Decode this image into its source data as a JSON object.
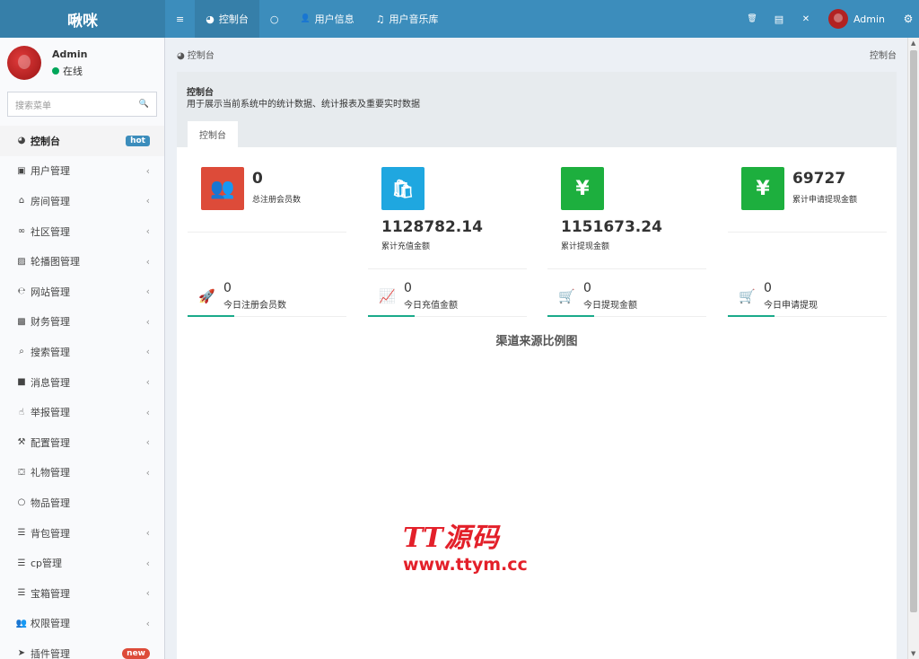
{
  "app": {
    "logo": "啾咪"
  },
  "topnav": {
    "menu_icon": "≡",
    "tabs": [
      {
        "label": "控制台",
        "icon": "dashboard-icon",
        "glyph": "◕"
      },
      {
        "label": "",
        "icon": "circle-icon",
        "glyph": "○"
      },
      {
        "label": "用户信息",
        "icon": "user-icon",
        "glyph": "👤"
      },
      {
        "label": "用户音乐库",
        "icon": "music-icon",
        "glyph": "♫"
      }
    ],
    "right_icons": [
      {
        "icon": "trash-icon",
        "glyph": "🗑"
      },
      {
        "icon": "translate-icon",
        "glyph": "▤"
      },
      {
        "icon": "fullscreen-icon",
        "glyph": "✕"
      }
    ],
    "user": "Admin",
    "settings_glyph": "⚙"
  },
  "sidebar": {
    "user_name": "Admin",
    "user_status": "在线",
    "search_placeholder": "搜索菜单",
    "search_glyph": "🔍",
    "items": [
      {
        "label": "控制台",
        "glyph": "◕",
        "icon": "dashboard-icon",
        "badge": "hot",
        "active": true
      },
      {
        "label": "用户管理",
        "glyph": "▣",
        "icon": "user-card-icon"
      },
      {
        "label": "房间管理",
        "glyph": "⌂",
        "icon": "bank-icon"
      },
      {
        "label": "社区管理",
        "glyph": "∞",
        "icon": "bicycle-icon"
      },
      {
        "label": "轮播图管理",
        "glyph": "▨",
        "icon": "image-icon"
      },
      {
        "label": "网站管理",
        "glyph": "℮",
        "icon": "ie-icon"
      },
      {
        "label": "财务管理",
        "glyph": "▩",
        "icon": "money-icon"
      },
      {
        "label": "搜索管理",
        "glyph": "⌕",
        "icon": "search-icon"
      },
      {
        "label": "消息管理",
        "glyph": "■",
        "icon": "message-icon"
      },
      {
        "label": "举报管理",
        "glyph": "☝",
        "icon": "hand-icon"
      },
      {
        "label": "配置管理",
        "glyph": "⚒",
        "icon": "sitemap-icon"
      },
      {
        "label": "礼物管理",
        "glyph": "⛋",
        "icon": "gift-icon"
      },
      {
        "label": "物品管理",
        "glyph": "○",
        "icon": "circle-icon",
        "nochev": true
      },
      {
        "label": "背包管理",
        "glyph": "☰",
        "icon": "list-icon"
      },
      {
        "label": "cp管理",
        "glyph": "☰",
        "icon": "list-icon"
      },
      {
        "label": "宝箱管理",
        "glyph": "☰",
        "icon": "list-icon"
      },
      {
        "label": "权限管理",
        "glyph": "👥",
        "icon": "users-icon"
      },
      {
        "label": "插件管理",
        "glyph": "➤",
        "icon": "rocket-icon",
        "badge": "new"
      }
    ]
  },
  "breadcrumb": {
    "left": "控制台",
    "right": "控制台",
    "glyph": "◕"
  },
  "panel": {
    "title": "控制台",
    "description": "用于展示当前系统中的统计数据、统计报表及重要实时数据",
    "tab": "控制台"
  },
  "stats": [
    {
      "value": "0",
      "label": "总注册会员数",
      "color": "#dd4b39",
      "glyph": "👥",
      "icon": "users-icon"
    },
    {
      "value": "1128782.14",
      "label": "累计充值金额",
      "color": "#1fa7e0",
      "glyph": "🛍",
      "icon": "shopping-bag-icon"
    },
    {
      "value": "1151673.24",
      "label": "累计提现金额",
      "color": "#1daf3e",
      "glyph": "¥",
      "icon": "yen-icon"
    },
    {
      "value": "69727",
      "label": "累计申请提现金额",
      "color": "#1daf3e",
      "glyph": "¥",
      "icon": "yen-icon"
    }
  ],
  "today": [
    {
      "value": "0",
      "label": "今日注册会员数",
      "glyph": "🚀",
      "icon": "rocket-icon"
    },
    {
      "value": "0",
      "label": "今日充值金额",
      "glyph": "📈",
      "icon": "line-chart-icon"
    },
    {
      "value": "0",
      "label": "今日提现金额",
      "glyph": "🛒",
      "icon": "cart-icon"
    },
    {
      "value": "0",
      "label": "今日申请提现",
      "glyph": "🛒",
      "icon": "cart-icon"
    }
  ],
  "chart": {
    "title": "渠道来源比例图"
  },
  "watermark": {
    "line1": "TT源码",
    "line2": "www.ttym.cc"
  }
}
